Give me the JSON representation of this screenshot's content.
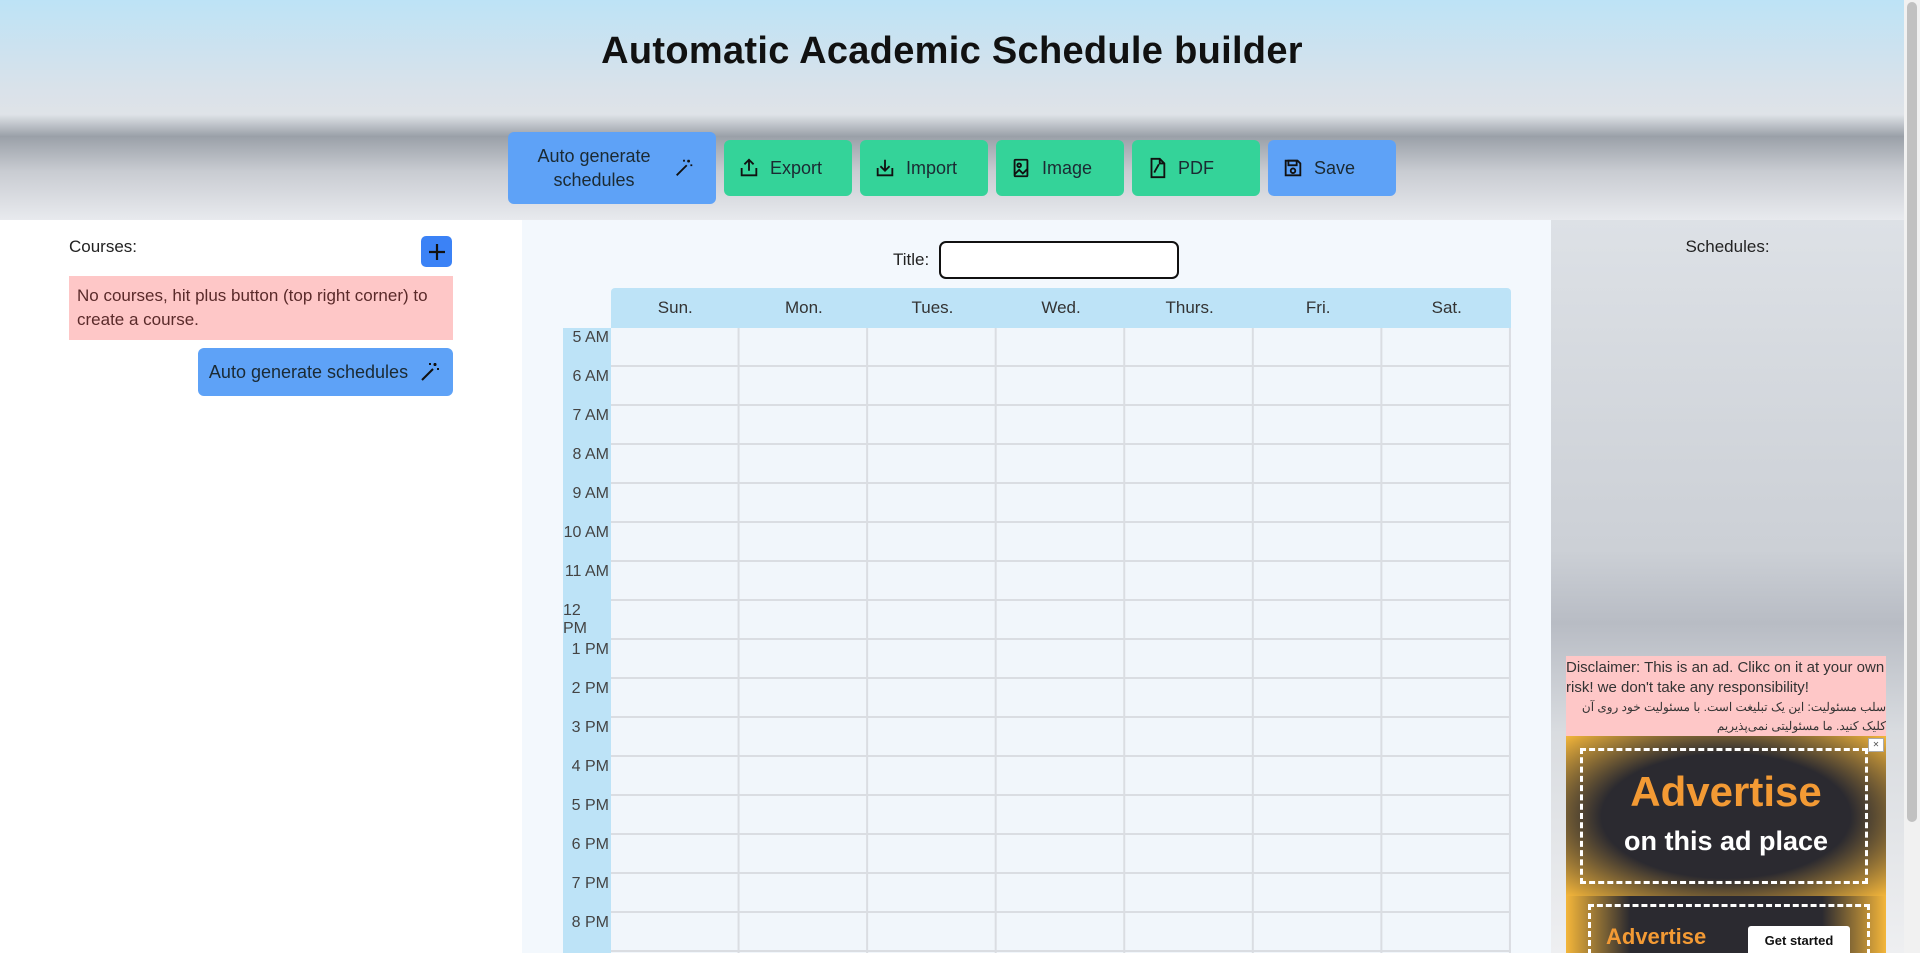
{
  "app_title": "Automatic Academic Schedule builder",
  "toolbar": {
    "auto_generate": "Auto generate schedules",
    "export": "Export",
    "import": "Import",
    "image": "Image",
    "pdf": "PDF",
    "save": "Save"
  },
  "courses": {
    "label": "Courses:",
    "empty_message": "No courses, hit plus button (top right corner) to create a course.",
    "auto_generate": "Auto generate schedules"
  },
  "schedule": {
    "title_label": "Title:",
    "title_value": "",
    "days": [
      "Sun.",
      "Mon.",
      "Tues.",
      "Wed.",
      "Thurs.",
      "Fri.",
      "Sat."
    ],
    "times": [
      "5 AM",
      "6 AM",
      "7 AM",
      "8 AM",
      "9 AM",
      "10 AM",
      "11 AM",
      "12 PM",
      "1 PM",
      "2 PM",
      "3 PM",
      "4 PM",
      "5 PM",
      "6 PM",
      "7 PM",
      "8 PM"
    ]
  },
  "schedules_panel": {
    "label": "Schedules:",
    "disclaimer_en": "Disclaimer: This is an ad. Clikc on it at your own risk! we don't take any responsibility!",
    "disclaimer_fa": "سلب مسئولیت: این یک تبلیغت است. با مسئولیت خود روی آن کلیک کنید. ما مسئولیتی نمی‌پذیریم",
    "ad1_big": "Advertise",
    "ad1_small": "on this ad place",
    "ad2_big": "Advertise",
    "ad2_button": "Get started"
  },
  "colors": {
    "green_button": "#34d399",
    "blue_button": "#5ea2f7",
    "error_bg": "#fec7c7",
    "day_header": "#bde3f7"
  }
}
